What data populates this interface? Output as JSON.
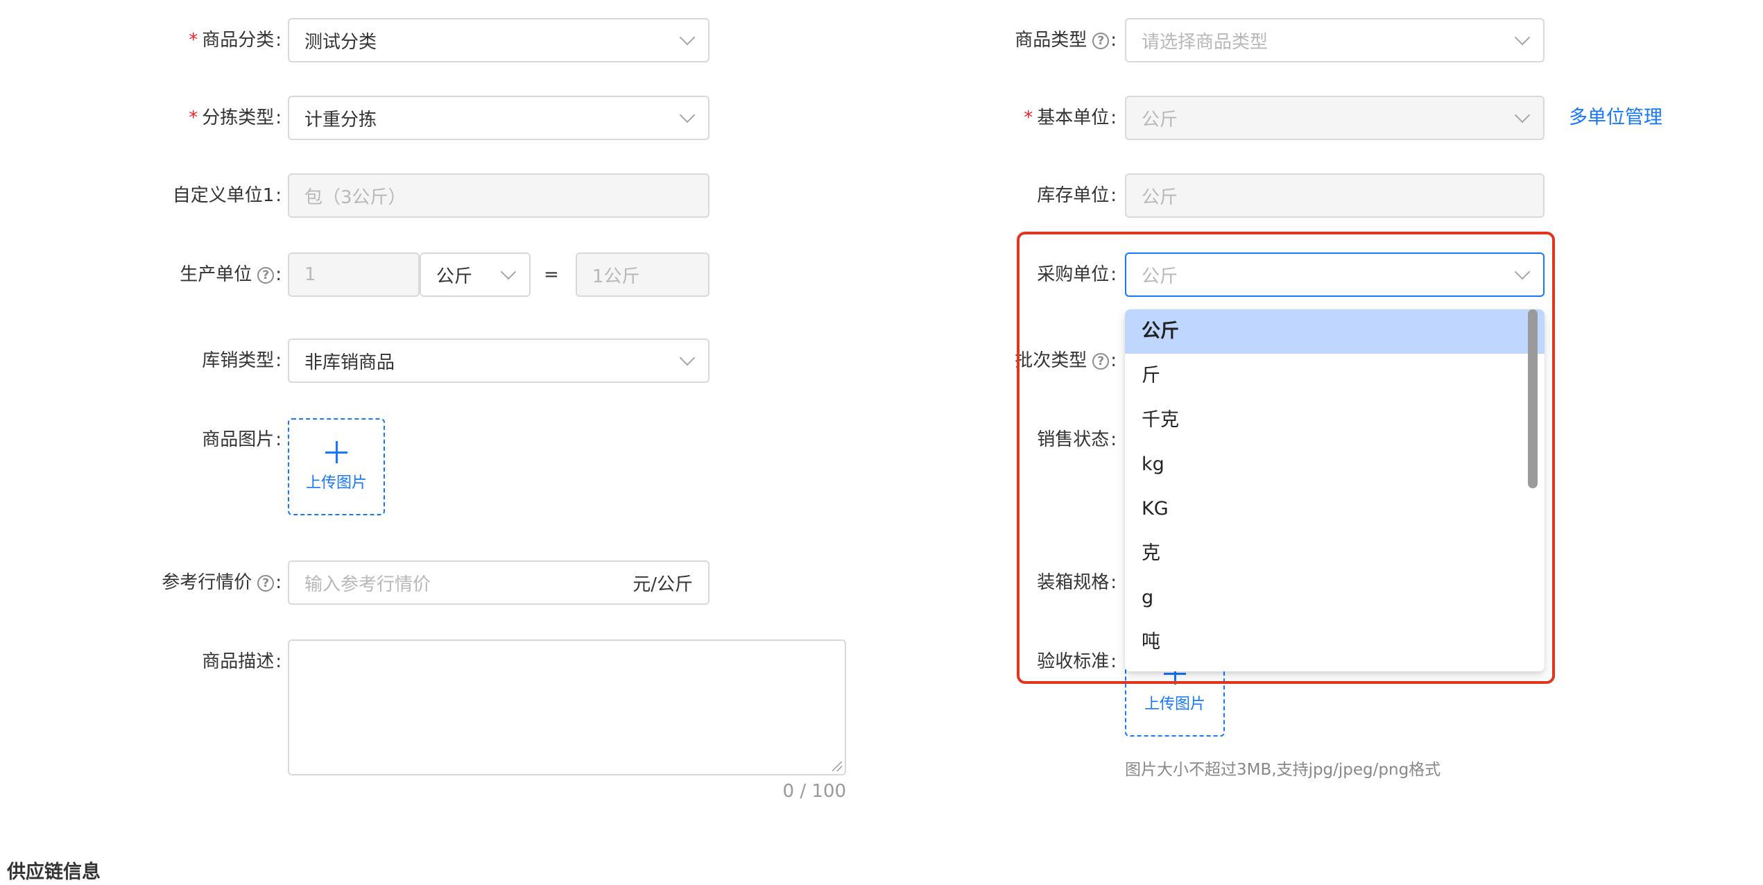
{
  "left_form": {
    "category": {
      "label": "商品分类",
      "value": "测试分类",
      "required": true
    },
    "sort_type": {
      "label": "分拣类型",
      "value": "计重分拣",
      "required": true
    },
    "custom_unit1": {
      "label": "自定义单位1",
      "value": "包（3公斤）"
    },
    "production_unit": {
      "label": "生产单位",
      "qty": "1",
      "unit": "公斤",
      "equals": "=",
      "result": "1公斤"
    },
    "stock_sale_type": {
      "label": "库销类型",
      "value": "非库销商品"
    },
    "product_image": {
      "label": "商品图片",
      "upload_text": "上传图片"
    },
    "ref_price": {
      "label": "参考行情价",
      "placeholder": "输入参考行情价",
      "suffix": "元/公斤"
    },
    "description": {
      "label": "商品描述",
      "counter": "0 / 100"
    }
  },
  "right_form": {
    "product_type": {
      "label": "商品类型",
      "placeholder": "请选择商品类型"
    },
    "base_unit": {
      "label": "基本单位",
      "value": "公斤",
      "required": true,
      "link": "多单位管理"
    },
    "inventory_unit": {
      "label": "库存单位",
      "value": "公斤"
    },
    "purchase_unit": {
      "label": "采购单位",
      "placeholder": "公斤"
    },
    "batch_type": {
      "label": "批次类型"
    },
    "sale_status": {
      "label": "销售状态"
    },
    "packing_spec": {
      "label": "装箱规格"
    },
    "acceptance": {
      "label": "验收标准",
      "upload_text": "上传图片",
      "hint": "图片大小不超过3MB,支持jpg/jpeg/png格式"
    }
  },
  "dropdown": {
    "options": [
      "公斤",
      "斤",
      "千克",
      "kg",
      "KG",
      "克",
      "g",
      "吨"
    ],
    "active_index": 0
  },
  "section": {
    "supply_chain_title": "供应链信息"
  },
  "colors": {
    "primary": "#1677ff",
    "required": "#f5222d",
    "highlight_frame": "#e0361f",
    "active_option": "#bfd6ff"
  }
}
